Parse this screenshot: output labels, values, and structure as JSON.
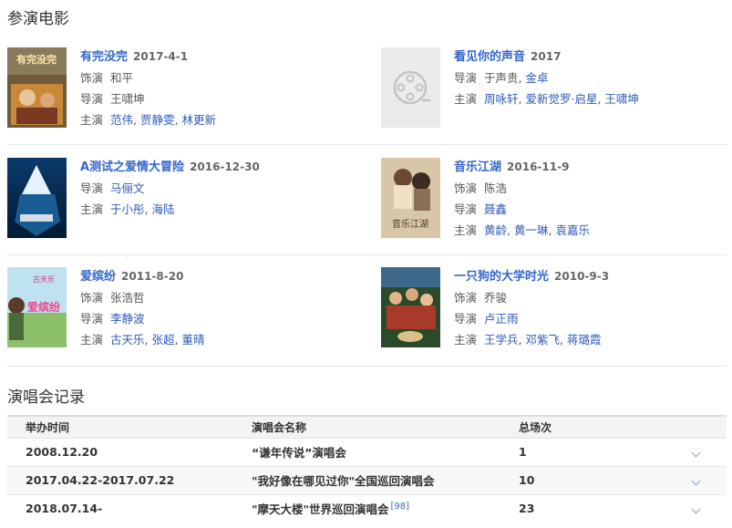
{
  "films_title": "参演电影",
  "concerts_title": "演唱会记录",
  "films": [
    {
      "name": "有完没完",
      "date": "2017-4-1",
      "rows": [
        {
          "label": "饰演",
          "values": [
            "和平"
          ],
          "links": false
        },
        {
          "label": "导演",
          "values": [
            "王啸坤"
          ],
          "links": false
        },
        {
          "label": "主演",
          "values": [
            "范伟",
            "贾静雯",
            "林更新"
          ],
          "links": true
        }
      ]
    },
    {
      "name": "看见你的声音",
      "date": "2017",
      "rows": [
        {
          "label": "导演",
          "values": [
            "于声贵",
            "金卓"
          ],
          "links": [
            false,
            true
          ]
        },
        {
          "label": "主演",
          "values": [
            "周咏轩",
            "爱新觉罗·启星",
            "王啸坤"
          ],
          "links": true
        }
      ]
    },
    {
      "name": "A测试之爱情大冒险",
      "date": "2016-12-30",
      "rows": [
        {
          "label": "导演",
          "values": [
            "马俪文"
          ],
          "links": true
        },
        {
          "label": "主演",
          "values": [
            "于小彤",
            "海陆"
          ],
          "links": true
        }
      ]
    },
    {
      "name": "音乐江湖",
      "date": "2016-11-9",
      "rows": [
        {
          "label": "饰演",
          "values": [
            "陈浩"
          ],
          "links": false
        },
        {
          "label": "导演",
          "values": [
            "聂鑫"
          ],
          "links": true
        },
        {
          "label": "主演",
          "values": [
            "黄龄",
            "黄一琳",
            "袁嘉乐"
          ],
          "links": true
        }
      ]
    },
    {
      "name": "爱缤纷",
      "date": "2011-8-20",
      "rows": [
        {
          "label": "饰演",
          "values": [
            "张浩哲"
          ],
          "links": false
        },
        {
          "label": "导演",
          "values": [
            "李静波"
          ],
          "links": true
        },
        {
          "label": "主演",
          "values": [
            "古天乐",
            "张超",
            "董晴"
          ],
          "links": true
        }
      ]
    },
    {
      "name": "一只狗的大学时光",
      "date": "2010-9-3",
      "rows": [
        {
          "label": "饰演",
          "values": [
            "乔骏"
          ],
          "links": false
        },
        {
          "label": "导演",
          "values": [
            "卢正雨"
          ],
          "links": true
        },
        {
          "label": "主演",
          "values": [
            "王学兵",
            "邓紫飞",
            "蒋璐霞"
          ],
          "links": true
        }
      ]
    }
  ],
  "poster_text": {
    "p0": "有完没完",
    "p4a": "古天乐",
    "p4b": "爱缤纷",
    "p3": "音乐江湖"
  },
  "concerts": {
    "headers": [
      "举办时间",
      "演唱会名称",
      "总场次"
    ],
    "rows": [
      {
        "time": "2008.12.20",
        "name": "“谦年传说”演唱会",
        "count": "1",
        "ref": ""
      },
      {
        "time": "2017.04.22-2017.07.22",
        "name": "\"我好像在哪见过你\"全国巡回演唱会",
        "count": "10",
        "ref": ""
      },
      {
        "time": "2018.07.14-",
        "name": "\"摩天大楼\"世界巡回演唱会",
        "count": "23",
        "ref": "[98]"
      }
    ]
  },
  "colors": {
    "link": "#3366cc",
    "text": "#555555"
  }
}
